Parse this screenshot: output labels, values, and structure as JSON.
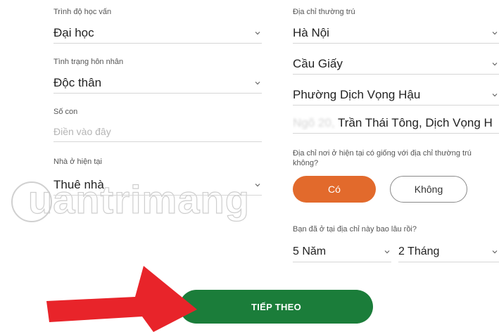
{
  "left": {
    "education": {
      "label": "Trình độ học vấn",
      "value": "Đại học"
    },
    "marital": {
      "label": "Tình trạng hôn nhân",
      "value": "Độc thân"
    },
    "children": {
      "label": "Số con",
      "placeholder": "Điền vào đây"
    },
    "housing": {
      "label": "Nhà ở hiện tại",
      "value": "Thuê nhà"
    }
  },
  "right": {
    "address_label": "Địa chỉ thường trú",
    "city": "Hà Nội",
    "district": "Cầu Giấy",
    "ward": "Phường Dịch Vọng Hậu",
    "street_blurred": "Ngõ 20,",
    "street": "Trần Thái Tông, Dịch Vọng H",
    "same_address_question": "Địa chỉ nơi ở hiện tại có giống với địa chỉ thường trú không?",
    "yes_label": "Có",
    "no_label": "Không",
    "duration_question": "Bạn đã ở tại địa chỉ này bao lâu rồi?",
    "years_value": "5 Năm",
    "months_value": "2 Tháng"
  },
  "next_button": "TIẾP THEO",
  "watermark": "uantrimang",
  "colors": {
    "yes_bg": "#e26a2c",
    "next_bg": "#1b7d3a",
    "arrow": "#e8242a",
    "text": "#222222"
  }
}
